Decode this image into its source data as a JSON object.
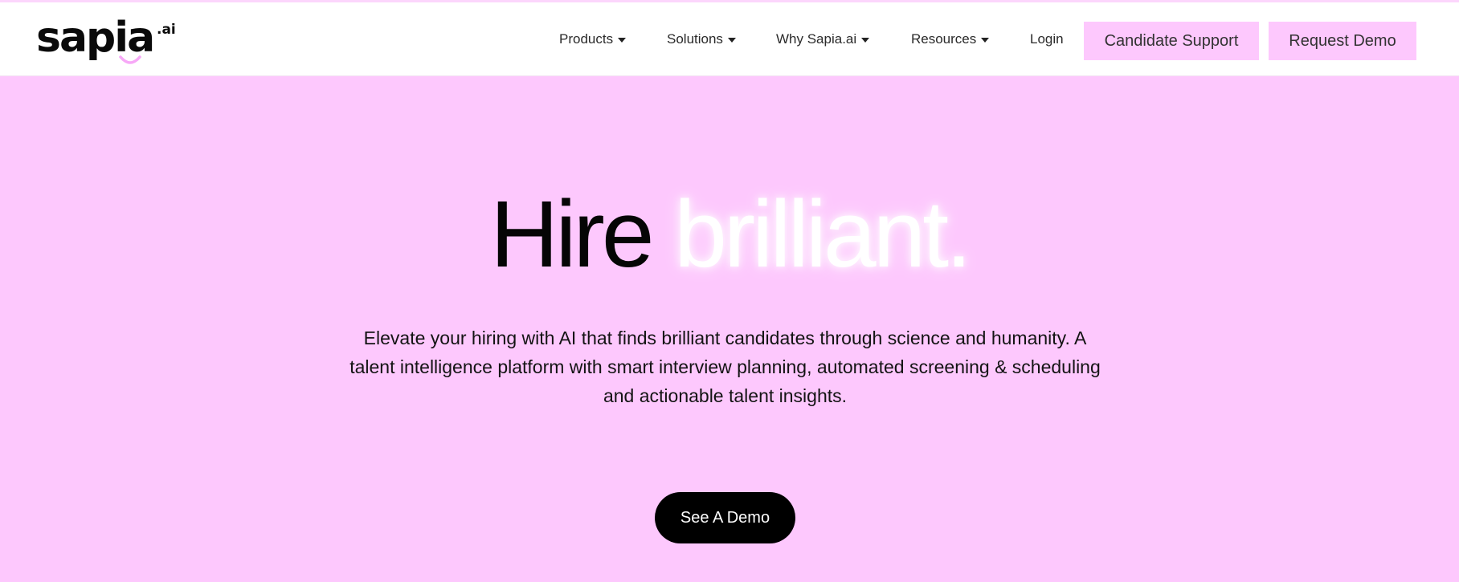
{
  "brand": {
    "name": "sapia",
    "suffix": ".ai",
    "accent_color": "#fdc8fd"
  },
  "nav": {
    "items": [
      {
        "label": "Products",
        "has_dropdown": true,
        "icon": "chevron-down-icon"
      },
      {
        "label": "Solutions",
        "has_dropdown": true,
        "icon": "chevron-down-icon"
      },
      {
        "label": "Why Sapia.ai",
        "has_dropdown": true,
        "icon": "chevron-down-icon"
      },
      {
        "label": "Resources",
        "has_dropdown": true,
        "icon": "chevron-down-icon"
      },
      {
        "label": "Login",
        "has_dropdown": false
      }
    ],
    "candidate_support_label": "Candidate Support",
    "request_demo_label": "Request Demo"
  },
  "hero": {
    "title_part1": "Hire",
    "title_part2": "brilliant.",
    "subtitle": "Elevate your hiring with AI that finds brilliant candidates through science and humanity. A talent intelligence platform with smart interview planning, automated screening & scheduling and actionable talent insights.",
    "cta_label": "See A Demo"
  }
}
